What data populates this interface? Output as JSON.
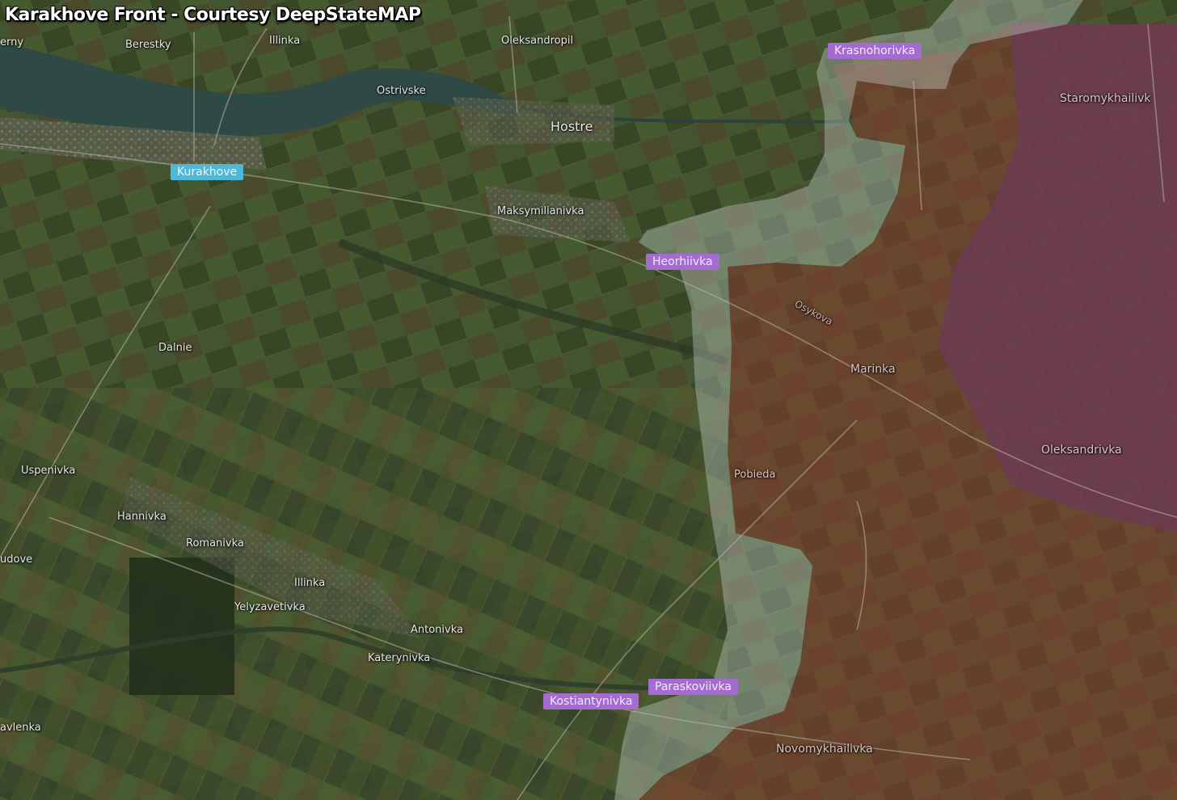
{
  "title": "Karakhove Front - Courtesy DeepStateMAP",
  "colors": {
    "ukraine_held_label": "#4fb8d6",
    "contested_label": "#a46bd1",
    "occupied_overlay": "#8b3a2e",
    "pre2022_occupied_overlay": "#6a3d6d",
    "grey_zone_overlay": "#c6d3cf"
  },
  "places": {
    "yerny": "erny",
    "berestky": "Berestky",
    "illinka_north": "Illinka",
    "oleksandropil": "Oleksandropil",
    "ostrivske": "Ostrivske",
    "hostre": "Hostre",
    "kurakhove": "Kurakhove",
    "maksymilianivka": "Maksymilianivka",
    "heorhiivka": "Heorhiivka",
    "krasnohorivka": "Krasnohorivka",
    "staromykhailivka": "Staromykhailivk",
    "osykova": "Osykova",
    "marinka": "Marinka",
    "dalnie": "Dalnie",
    "oleksandrivka": "Oleksandrivka",
    "pobieda": "Pobieda",
    "uspenivka": "Uspenivka",
    "hannivka": "Hannivka",
    "romanivka": "Romanivka",
    "udove": "udove",
    "illinka_south": "Illinka",
    "yelyzavetivka": "Yelyzavetivka",
    "antonivka": "Antonivka",
    "katerynivka": "Katerynivka",
    "paraskoviivka": "Paraskoviivka",
    "kostiantynivka": "Kostiantynivka",
    "novomykhailivka": "Novomykhailivka",
    "pavlenka": "avlenka"
  }
}
